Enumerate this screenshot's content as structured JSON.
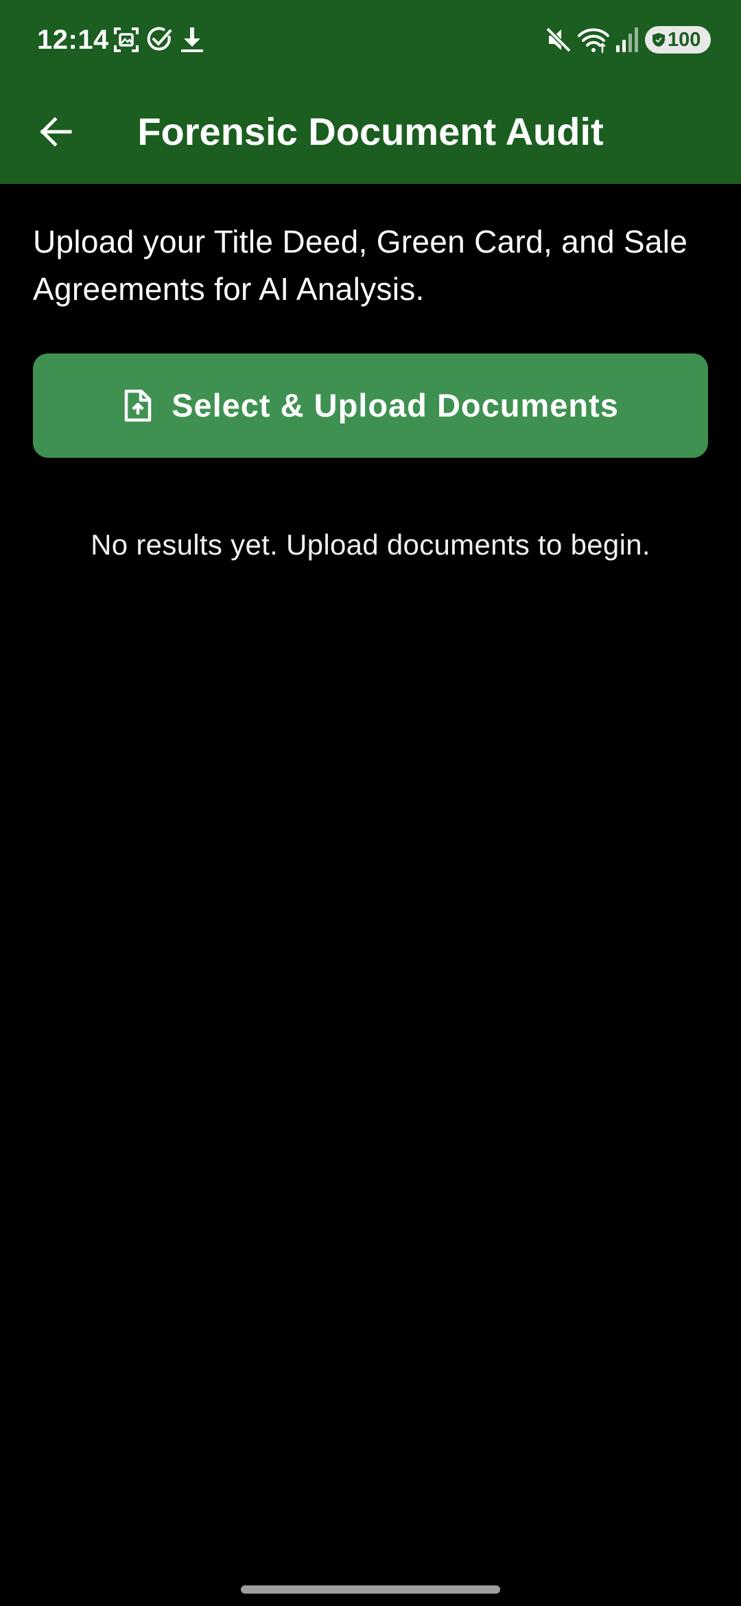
{
  "status_bar": {
    "time": "12:14",
    "battery_level": "100",
    "icons": [
      "screenshot-icon",
      "check-circle-icon",
      "download-icon",
      "mute-icon",
      "wifi-icon",
      "signal-icon",
      "battery-shield-icon"
    ]
  },
  "app_bar": {
    "title": "Forensic Document Audit",
    "back_icon": "arrow-left-icon"
  },
  "main": {
    "intro": "Upload your Title Deed, Green Card, and Sale Agreements for AI Analysis.",
    "upload_button": {
      "label": "Select & Upload Documents",
      "icon": "file-upload-icon"
    },
    "empty_state": "No results yet. Upload documents to begin."
  },
  "colors": {
    "header": "#1b5e20",
    "button": "#3f9152",
    "background": "#000000",
    "text": "#ffffff"
  }
}
